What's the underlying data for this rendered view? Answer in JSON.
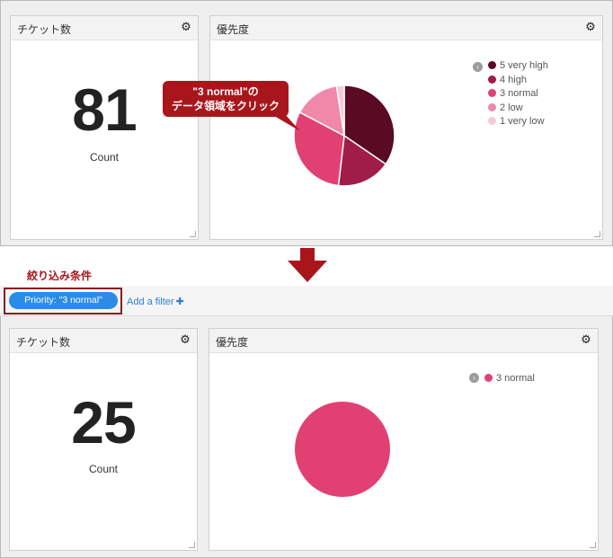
{
  "before": {
    "count_panel": {
      "title": "チケット数",
      "value": "81",
      "label": "Count"
    },
    "priority_panel": {
      "title": "優先度",
      "legend": [
        {
          "label": "5 very high",
          "color": "#5a0a22"
        },
        {
          "label": "4 high",
          "color": "#a01d49"
        },
        {
          "label": "3 normal",
          "color": "#e14073"
        },
        {
          "label": "2 low",
          "color": "#f088aa"
        },
        {
          "label": "1 very low",
          "color": "#f7cad8"
        }
      ]
    }
  },
  "callout": {
    "line1": "\"3 normal\"の",
    "line2": "データ領域をクリック"
  },
  "filter_caption": "絞り込み条件",
  "filter_bar": {
    "active_filter": "Priority: \"3 normal\"",
    "add_filter_label": "Add a filter"
  },
  "after": {
    "count_panel": {
      "title": "チケット数",
      "value": "25",
      "label": "Count"
    },
    "priority_panel": {
      "title": "優先度",
      "legend": [
        {
          "label": "3 normal",
          "color": "#e14073"
        }
      ]
    }
  },
  "chart_data": [
    {
      "type": "pie",
      "categories": [
        "5 very high",
        "4 high",
        "3 normal",
        "2 low",
        "1 very low"
      ],
      "values": [
        28,
        14,
        25,
        12,
        2
      ],
      "colors": [
        "#5a0a22",
        "#a01d49",
        "#e14073",
        "#f088aa",
        "#f7cad8"
      ],
      "legend": "right"
    },
    {
      "type": "pie",
      "categories": [
        "3 normal"
      ],
      "values": [
        25
      ],
      "colors": [
        "#e14073"
      ],
      "legend": "right"
    }
  ]
}
